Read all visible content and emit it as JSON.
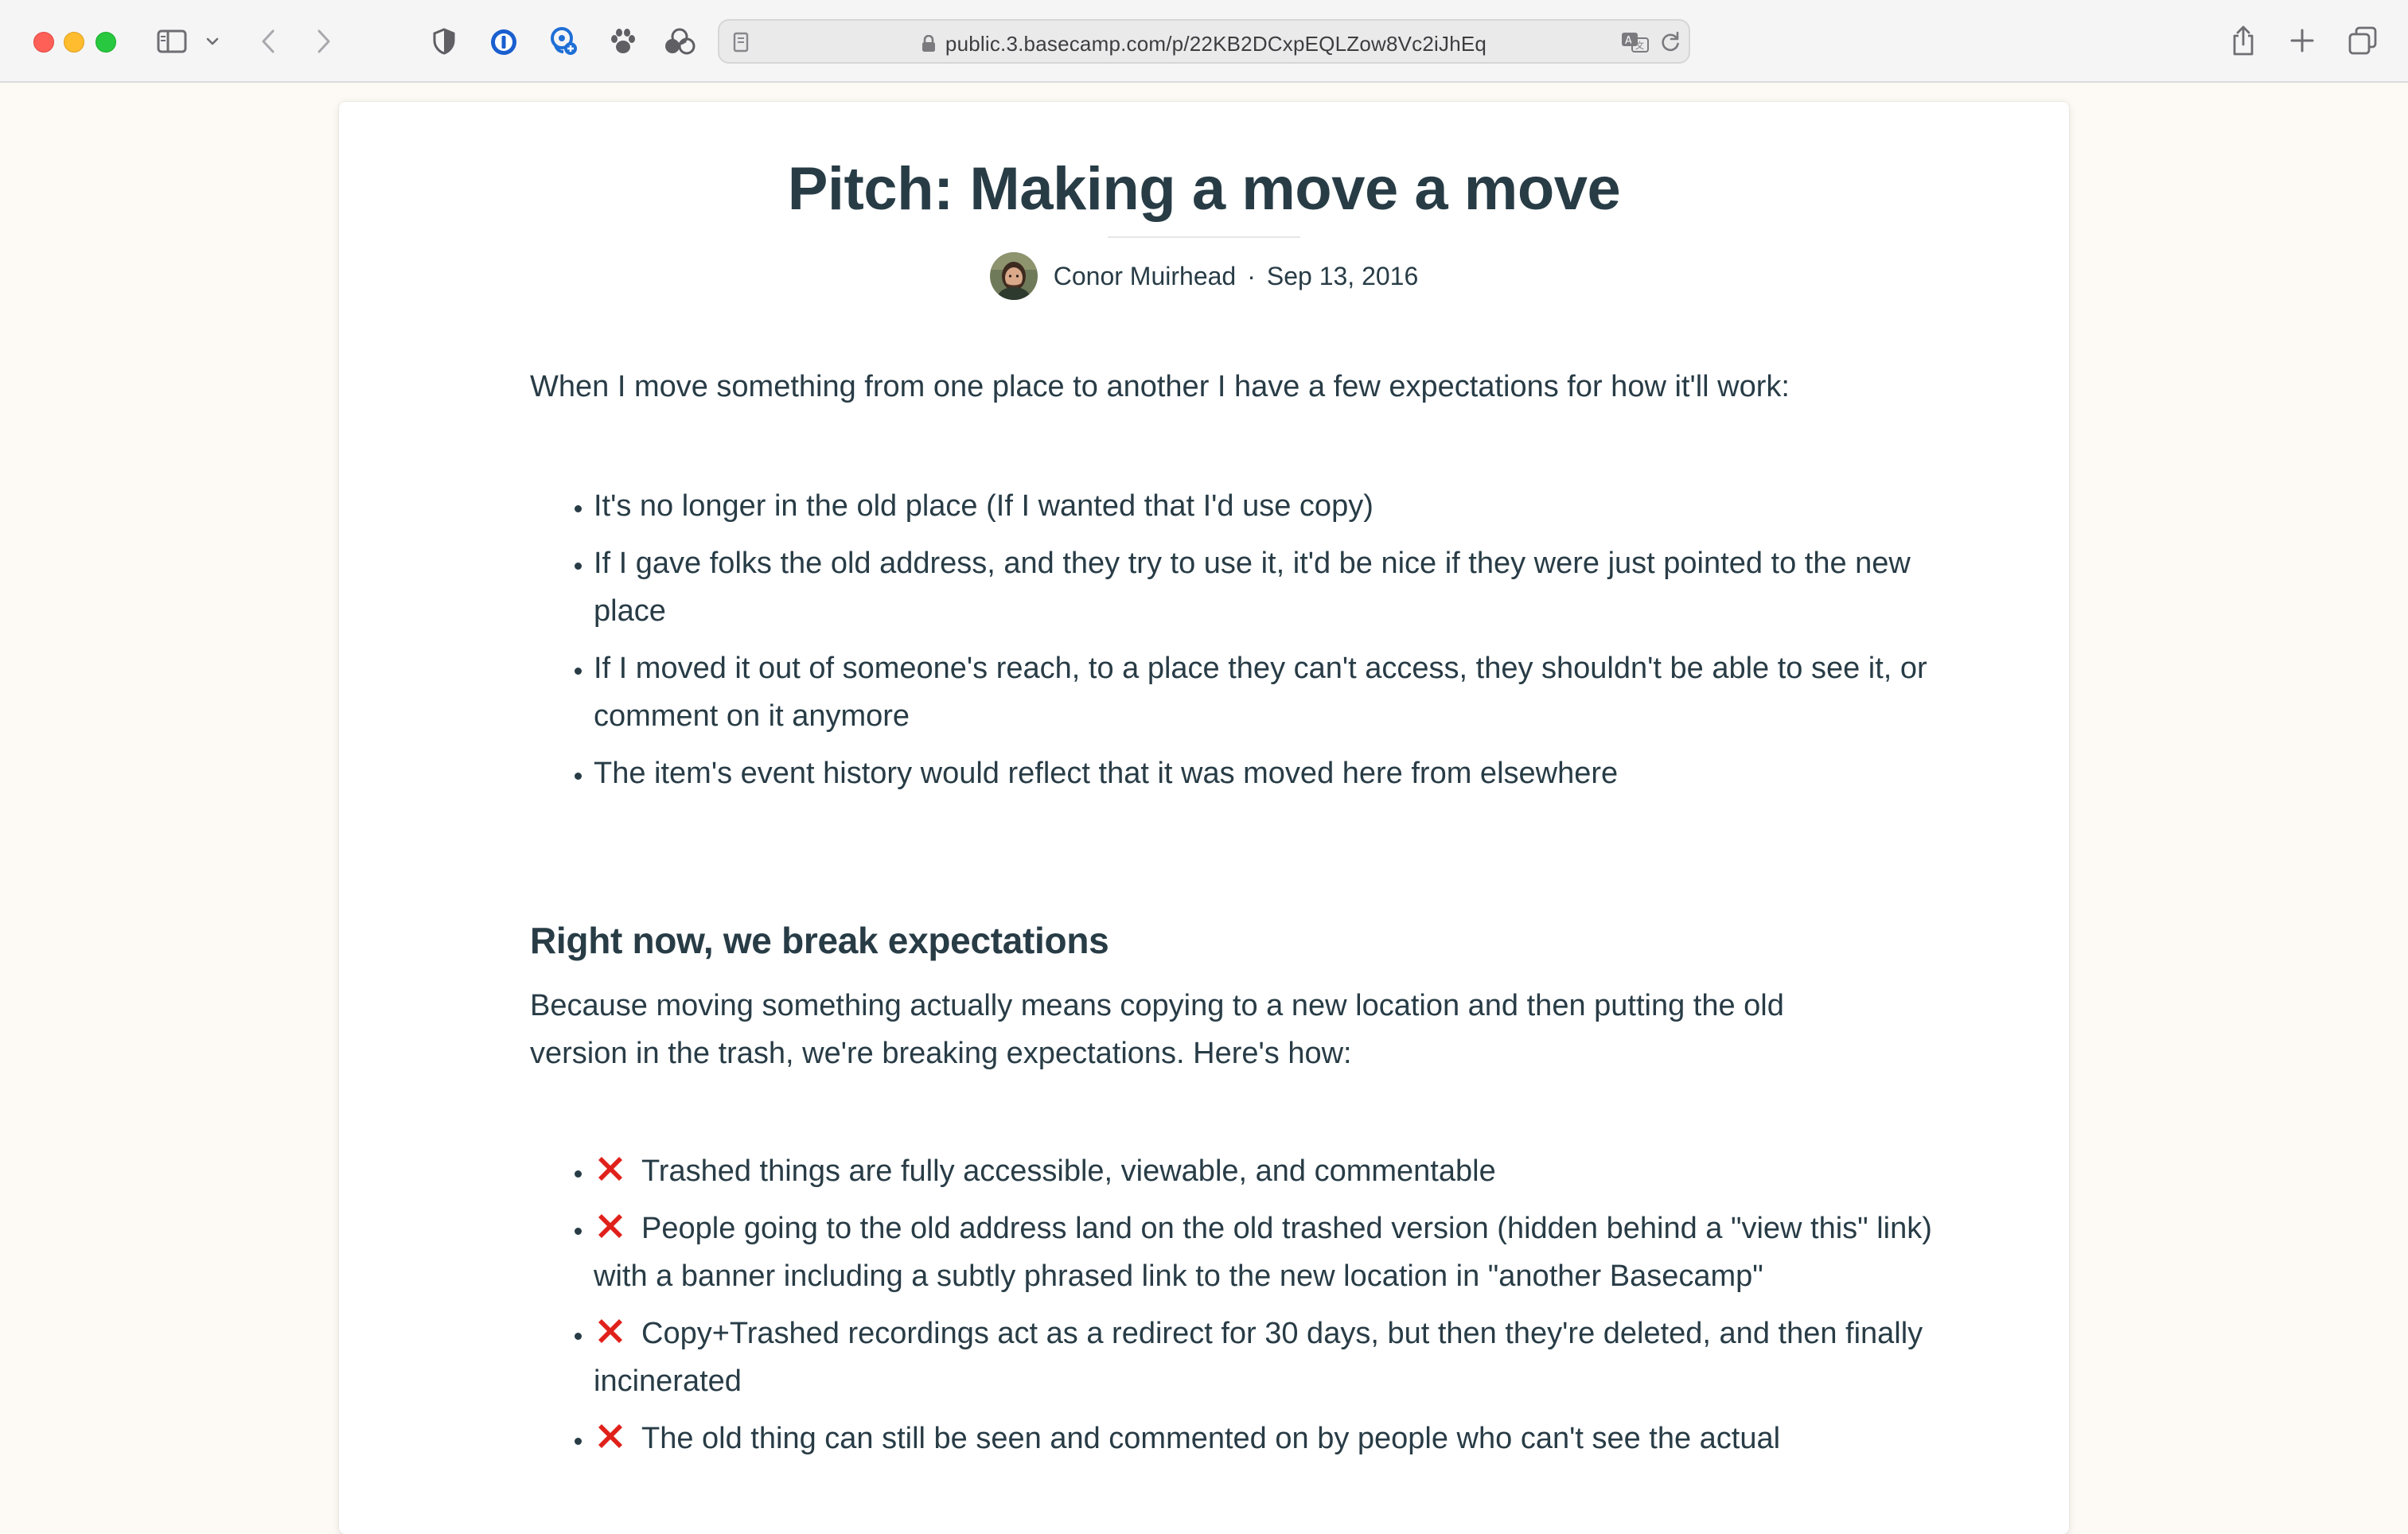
{
  "browser": {
    "url": "public.3.basecamp.com/p/22KB2DCxpEQLZow8Vc2iJhEq",
    "icons": [
      "sidebar-icon",
      "chevron-down-icon",
      "back-icon",
      "forward-icon",
      "shield-icon",
      "password-manager-icon",
      "extension-icon",
      "paw-icon",
      "extension-cluster-icon",
      "reader-icon",
      "lock-icon",
      "translate-icon",
      "reload-icon",
      "share-icon",
      "new-tab-icon",
      "tab-overview-icon"
    ]
  },
  "document": {
    "title": "Pitch: Making a move a move",
    "author": "Conor Muirhead",
    "separator": "·",
    "date": "Sep 13, 2016",
    "intro": "When I move something from one place to another I have a few expectations for how it'll work:",
    "expectations": [
      "It's no longer in the old place (If I wanted that I'd use copy)",
      "If I gave folks the old address, and they try to use it, it'd be nice if they were just pointed to the new place",
      "If I moved it out of someone's reach, to a place they can't access, they shouldn't be able to see it, or comment on it anymore",
      "The item's event history would reflect that it was moved here from elsewhere"
    ],
    "section_heading": "Right now, we break expectations",
    "section_text": "Because moving something actually means copying to a new location and then putting the old version in the trash, we're breaking expectations. Here's how:",
    "breaks": [
      "Trashed things are fully accessible, viewable, and commentable",
      "People going to the old address land on the old trashed version (hidden behind a \"view this\" link) with a banner including a subtly phrased link to the new location in \"another Basecamp\"",
      "Copy+Trashed recordings act as a redirect for 30 days, but then they're deleted, and then finally incinerated",
      "The old thing can still be seen and commented on by people who can't see the actual"
    ]
  },
  "colors": {
    "text": "#283c46",
    "background": "#fdf9f5",
    "cross": "#e0211b"
  }
}
